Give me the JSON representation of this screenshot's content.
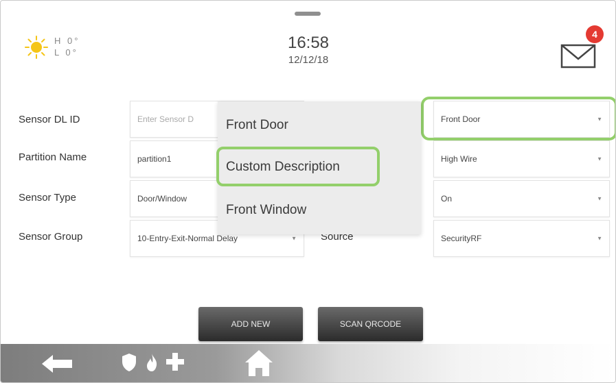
{
  "header": {
    "weather": {
      "hi": "H 0°",
      "lo": "L 0°"
    },
    "time": "16:58",
    "date": "12/12/18",
    "messages_count": "4"
  },
  "form": {
    "sensor_dl_id": {
      "label": "Sensor DL ID",
      "placeholder": "Enter Sensor D"
    },
    "partition_name": {
      "label": "Partition Name",
      "value": "partition1"
    },
    "sensor_type": {
      "label": "Sensor Type",
      "value": "Door/Window"
    },
    "sensor_group": {
      "label": "Sensor Group",
      "value": "10-Entry-Exit-Normal Delay"
    },
    "source": {
      "label": "Source"
    },
    "right_column": {
      "sensor_name": "Front Door",
      "chime_type": "High Wire",
      "voice_prompt": "On",
      "source_value": "SecurityRF"
    }
  },
  "dropdown": {
    "options": [
      "Front Door",
      "Custom Description",
      "Front Window"
    ],
    "highlighted": "Custom Description"
  },
  "buttons": {
    "add_new": "ADD NEW",
    "scan_qrcode": "SCAN QRCODE"
  },
  "bottom_nav": {
    "icons": [
      "back-arrow-icon",
      "shield-icon",
      "fire-icon",
      "medical-cross-icon",
      "home-icon"
    ]
  },
  "colors": {
    "highlight": "#93cf6b",
    "badge": "#e43a32",
    "sun": "#f5c518"
  }
}
